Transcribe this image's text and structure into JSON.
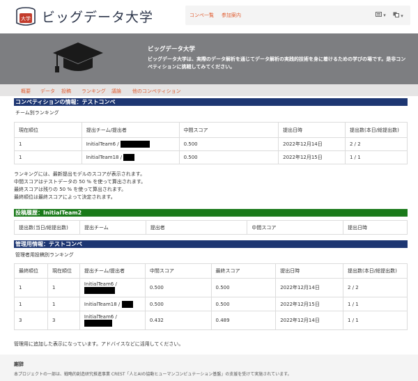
{
  "header": {
    "logo_text": "大学",
    "brand": "ビッグデータ大学",
    "nav": [
      {
        "label": "コンペ一覧"
      },
      {
        "label": "参加案内"
      }
    ],
    "icons": [
      "message-icon",
      "translate-icon"
    ]
  },
  "hero": {
    "title": "ビッグデータ大学",
    "description": "ビッグデータ大学は、実際のデータ解析を通じてデータ解析の実践的技術を身に着けるための学びの場です。是非コンペティションに挑戦してみてください。"
  },
  "subnav": [
    {
      "label": "概要"
    },
    {
      "label": "データ"
    },
    {
      "label": "投稿"
    },
    {
      "label": "ランキング"
    },
    {
      "label": "議論"
    },
    {
      "label": "他のコンペティション"
    }
  ],
  "competition": {
    "bar_title": "コンペティションの情報：テストコンペ",
    "subtitle": "チーム別ランキング",
    "headers": [
      "現在順位",
      "提出チーム/提出者",
      "中間スコア",
      "提出日時",
      "提出数(本日/総提出数)"
    ],
    "rows": [
      {
        "rank": "1",
        "team": "InitialTeam6 /",
        "score": "0.500",
        "date": "2022年12月14日",
        "count": "2 / 2"
      },
      {
        "rank": "1",
        "team": "InitialTeam18 /",
        "score": "0.500",
        "date": "2022年12月15日",
        "count": "1 / 1"
      }
    ],
    "notes": [
      "ランキングには、最新提出モデルのスコアが表示されます。",
      "中間スコアはテストデータの 50 % を使って算出されます。",
      "最終スコアは残りの 50 % を使って算出されます。",
      "最終順位は最終スコアによって決定されます。"
    ]
  },
  "history": {
    "bar_title": "投稿履歴：InitialTeam2",
    "headers": [
      "提出数(当日/総提出数)",
      "提出チーム",
      "提出者",
      "中間スコア",
      "提出日時"
    ]
  },
  "admin": {
    "bar_title": "管理用情報：テストコンペ",
    "subtitle": "管理者用投稿別ランキング",
    "headers": [
      "最終順位",
      "現在順位",
      "提出チーム/提出者",
      "中間スコア",
      "最終スコア",
      "提出日時",
      "提出数(本日/総提出数)"
    ],
    "rows": [
      {
        "final": "1",
        "current": "1",
        "team": "InitialTeam6 /",
        "mid": "0.500",
        "fin": "0.500",
        "date": "2022年12月14日",
        "count": "2 / 2"
      },
      {
        "final": "1",
        "current": "1",
        "team": "InitialTeam18 /",
        "mid": "0.500",
        "fin": "0.500",
        "date": "2022年12月15日",
        "count": "1 / 1"
      },
      {
        "final": "3",
        "current": "3",
        "team": "InitialTeam6 /",
        "mid": "0.432",
        "fin": "0.489",
        "date": "2022年12月14日",
        "count": "1 / 1"
      }
    ],
    "note": "管理用に追加した表示になっています。アドバイスなどに活用してください。"
  },
  "footer": {
    "title": "謝辞",
    "text": "本プロジェクトの一部は、戦略的創造研究推進事業 CREST「人とAIの協動ヒューマンコンピュテーション基盤」の支援を受けて実施されています。"
  }
}
